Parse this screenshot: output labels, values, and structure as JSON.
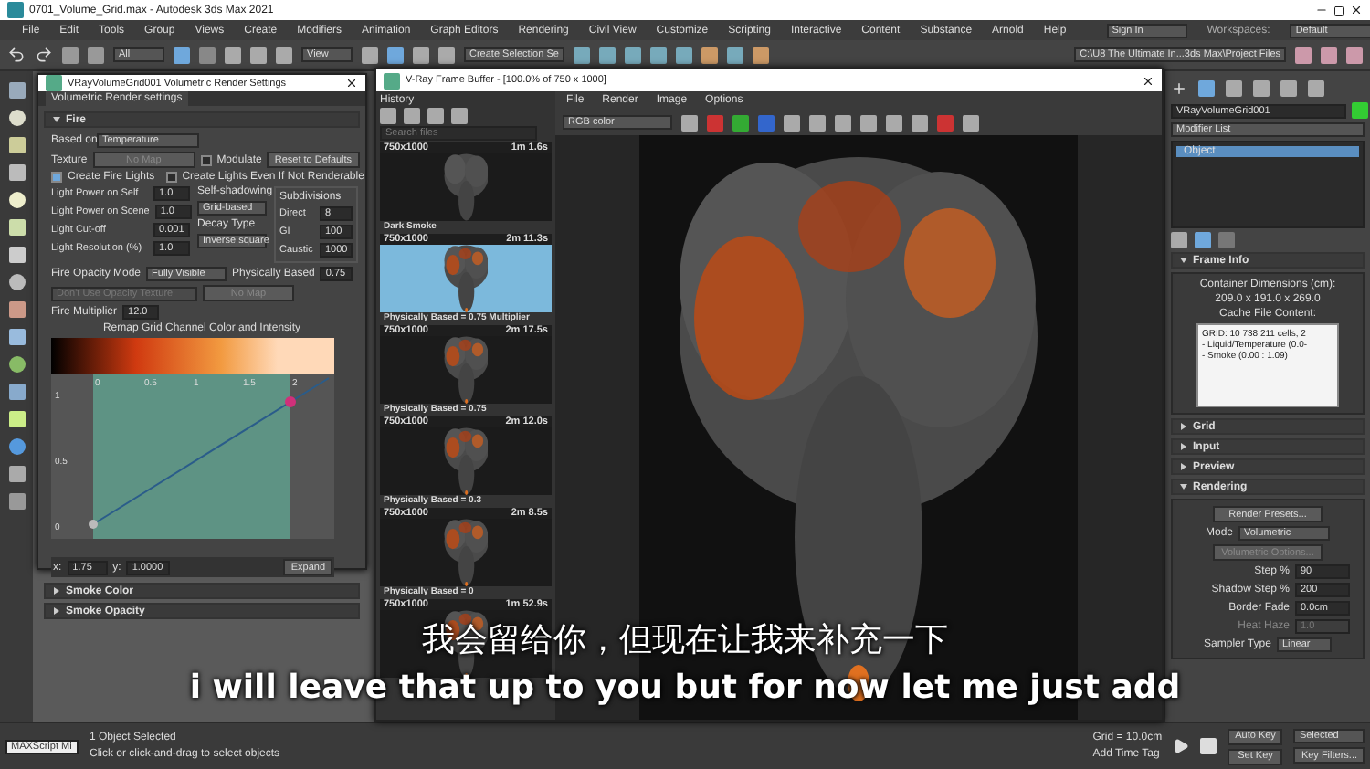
{
  "window": {
    "title": "0701_Volume_Grid.max - Autodesk 3ds Max 2021"
  },
  "menu": [
    "File",
    "Edit",
    "Tools",
    "Group",
    "Views",
    "Create",
    "Modifiers",
    "Animation",
    "Graph Editors",
    "Rendering",
    "Civil View",
    "Customize",
    "Scripting",
    "Interactive",
    "Content",
    "Substance",
    "Arnold",
    "Help"
  ],
  "account": {
    "label": "Sign In"
  },
  "workspace": {
    "label": "Workspaces:",
    "value": "Default"
  },
  "toolbar": {
    "filter": "All",
    "view": "View",
    "selection_set": "Create Selection Se",
    "project_path": "C:\\U8 The Ultimate In...3ds Max\\Project Files"
  },
  "volume_settings": {
    "title": "VRayVolumeGrid001 Volumetric Render Settings",
    "tab": "Volumetric Render settings",
    "sections": [
      {
        "title": "Fire",
        "expanded": true
      },
      {
        "title": "Smoke Color",
        "expanded": false
      },
      {
        "title": "Smoke Opacity",
        "expanded": false
      }
    ],
    "based_on": {
      "label": "Based on",
      "value": "Temperature"
    },
    "texture": {
      "label": "Texture",
      "value": "No Map"
    },
    "modulate": {
      "label": "Modulate",
      "checked": false
    },
    "reset": "Reset to Defaults",
    "create_fire_lights": {
      "label": "Create Fire Lights",
      "checked": true
    },
    "create_even": {
      "label": "Create Lights Even If Not Renderable",
      "checked": false
    },
    "light_params": [
      {
        "label": "Light Power on Self",
        "value": "1.0"
      },
      {
        "label": "Light Power on Scene",
        "value": "1.0"
      },
      {
        "label": "Light Cut-off",
        "value": "0.001"
      },
      {
        "label": "Light Resolution (%)",
        "value": "1.0"
      }
    ],
    "self_shadowing": {
      "label": "Self-shadowing",
      "value": "Grid-based"
    },
    "decay": {
      "label": "Decay Type",
      "value": "Inverse square"
    },
    "subdivisions": {
      "title": "Subdivisions",
      "rows": [
        {
          "label": "Direct",
          "value": "8"
        },
        {
          "label": "GI",
          "value": "100"
        },
        {
          "label": "Caustic",
          "value": "1000"
        }
      ]
    },
    "opacity_mode": {
      "label": "Fire Opacity Mode",
      "value": "Fully Visible"
    },
    "physically_based": {
      "label": "Physically Based",
      "value": "0.75"
    },
    "opacity_texture": {
      "label": "Don't Use Opacity Texture",
      "disabled": true
    },
    "opacity_map": "No Map",
    "fire_multiplier": {
      "label": "Fire Multiplier",
      "value": "12.0"
    },
    "curve": {
      "title": "Remap Grid Channel Color and Intensity",
      "x_labels": [
        "0",
        "0.5",
        "1",
        "1.5",
        "2"
      ],
      "y_labels": [
        "1",
        "0.5",
        "0"
      ],
      "x_label": "x:",
      "x_value": "1.75",
      "y_label": "y:",
      "y_value": "1.0000",
      "expand": "Expand"
    }
  },
  "frame_buffer": {
    "title": "V-Ray Frame Buffer - [100.0% of 750 x 1000]",
    "menu": [
      "File",
      "Render",
      "Image",
      "Options"
    ],
    "history_title": "History",
    "search": {
      "placeholder": "Search files"
    },
    "channel": "RGB color",
    "history": [
      {
        "size": "750x1000",
        "time": "1m 1.6s",
        "name": "Dark Smoke",
        "selected": false,
        "fire": false
      },
      {
        "size": "750x1000",
        "time": "2m 11.3s",
        "name": "Physically Based = 0.75  Multiplier",
        "selected": true,
        "fire": true
      },
      {
        "size": "750x1000",
        "time": "2m 17.5s",
        "name": "Physically Based = 0.75",
        "selected": false,
        "fire": true
      },
      {
        "size": "750x1000",
        "time": "2m 12.0s",
        "name": "Physically Based = 0.3",
        "selected": false,
        "fire": true
      },
      {
        "size": "750x1000",
        "time": "2m 8.5s",
        "name": "Physically Based = 0",
        "selected": false,
        "fire": true
      },
      {
        "size": "750x1000",
        "time": "1m 52.9s",
        "selected": false,
        "fire": true
      }
    ]
  },
  "command_panel": {
    "object_name": "VRayVolumeGrid001",
    "modifier_list": "Modifier List",
    "stack": [
      {
        "label": "Object",
        "selected": true
      }
    ],
    "sections": [
      {
        "title": "Frame Info",
        "expanded": true,
        "kind": "frame_info"
      },
      {
        "title": "Grid",
        "expanded": false
      },
      {
        "title": "Input",
        "expanded": false
      },
      {
        "title": "Preview",
        "expanded": false
      },
      {
        "title": "Rendering",
        "expanded": true,
        "kind": "rendering"
      }
    ],
    "frame_info": {
      "lines": [
        "Container Dimensions (cm):",
        "209.0 x 191.0 x 269.0",
        "Cache File Content:"
      ],
      "cache": [
        "GRID: 10 738 211 cells, 2",
        "- Liquid/Temperature (0.0-",
        "- Smoke (0.00 : 1.09)"
      ]
    },
    "rendering": {
      "presets": "Render Presets...",
      "mode": {
        "label": "Mode",
        "value": "Volumetric"
      },
      "options": "Volumetric Options...",
      "params": [
        {
          "label": "Step %",
          "value": "90",
          "disabled": false
        },
        {
          "label": "Shadow Step %",
          "value": "200",
          "disabled": false
        },
        {
          "label": "Border Fade",
          "value": "0.0cm",
          "disabled": false
        },
        {
          "label": "Heat Haze",
          "value": "1.0",
          "disabled": true
        }
      ],
      "sampler": {
        "label": "Sampler Type",
        "value": "Linear"
      }
    }
  },
  "status": {
    "script": "MAXScript Mi",
    "selection": "1 Object Selected",
    "prompt": "Click or click-and-drag to select objects",
    "grid": "Grid = 10.0cm",
    "time_tag": "Add Time Tag",
    "auto_key": "Auto Key",
    "key_mode": "Selected",
    "set_key": "Set Key",
    "key_filters": "Key Filters..."
  },
  "subtitles": [
    "我会留给你，但现在让我来补充一下",
    "i will leave that up to you but for now let me just add"
  ]
}
